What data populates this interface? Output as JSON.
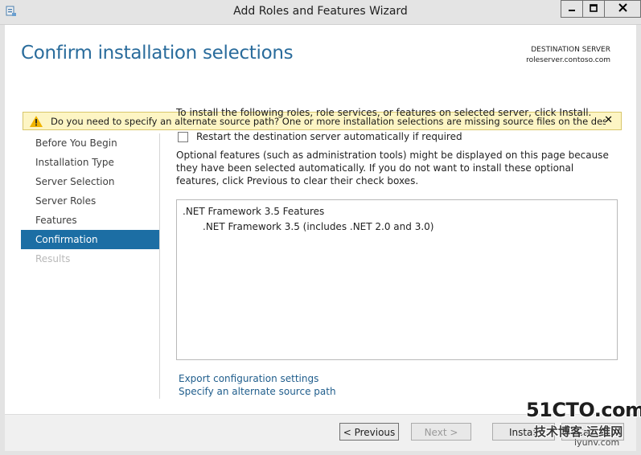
{
  "window": {
    "title": "Add Roles and Features Wizard",
    "min_glyph": "▬",
    "max_glyph": "□",
    "close_glyph": "✕"
  },
  "header": {
    "page_title": "Confirm installation selections",
    "destination_label": "DESTINATION SERVER",
    "destination_server": "roleserver.contoso.com"
  },
  "warning": {
    "text": "Do you need to specify an alternate source path? One or more installation selections are missing source files on the destinati...",
    "close_glyph": "✕"
  },
  "nav": {
    "items": [
      {
        "label": "Before You Begin"
      },
      {
        "label": "Installation Type"
      },
      {
        "label": "Server Selection"
      },
      {
        "label": "Server Roles"
      },
      {
        "label": "Features"
      },
      {
        "label": "Confirmation"
      },
      {
        "label": "Results"
      }
    ]
  },
  "main": {
    "intro": "To install the following roles, role services, or features on selected server, click Install.",
    "restart_label": "Restart the destination server automatically if required",
    "optional_text": "Optional features (such as administration tools) might be displayed on this page because they have been selected automatically. If you do not want to install these optional features, click Previous to clear their check boxes.",
    "list": [
      {
        "label": ".NET Framework 3.5 Features"
      },
      {
        "label": ".NET Framework 3.5 (includes .NET 2.0 and 3.0)"
      }
    ],
    "export_link": "Export configuration settings",
    "alt_source_link": "Specify an alternate source path"
  },
  "buttons": {
    "previous": "< Previous",
    "next": "Next >",
    "install": "Install",
    "cancel": "Cancel"
  },
  "watermark": {
    "main": "51CTO.com",
    "sub": "技术博客 运维网",
    "url": "iyunv.com"
  },
  "colors": {
    "accent": "#1c6ea4",
    "title_blue": "#2a6c9c",
    "warning_bg": "#fdf5c4",
    "link": "#1f5d8c"
  }
}
